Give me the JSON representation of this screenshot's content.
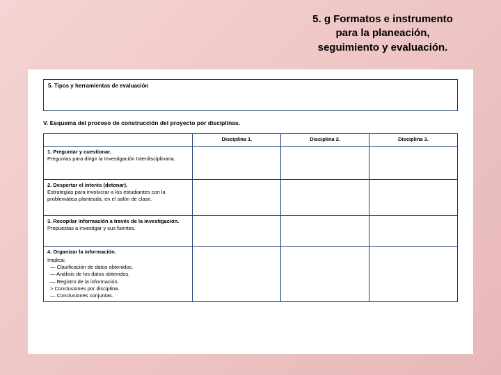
{
  "title": {
    "line1": "5. g Formatos e instrumento",
    "line2": "para la planeación,",
    "line3": "seguimiento y evaluación."
  },
  "boxA": {
    "label": "5. Tipos y herramientas de evaluación"
  },
  "sectionV": "V. Esquema del proceso de construcción del proyecto por disciplinas.",
  "headers": {
    "d1": "Disciplina 1.",
    "d2": "Disciplina 2.",
    "d3": "Disciplina 3."
  },
  "rows": {
    "r1": {
      "label": "1. Preguntar y cuestionar.",
      "sub": "Preguntas para dirigir la Investigación Interdisciplinaria."
    },
    "r2": {
      "label": "2. Despertar el interés (detonar).",
      "sub": "Estrategias para involucrar a los estudiantes con la problemática planteada, en el salón de clase."
    },
    "r3": {
      "label": "3. Recopilar información a través de la investigación.",
      "sub": "Propuestas a investigar y sus fuentes."
    },
    "r4": {
      "label": "4. Organizar la información.",
      "implies": "Implica:",
      "b1": "— Clasificación de datos obtenidos.",
      "b2": "— Análisis de los datos obtenidos.",
      "b3": "— Registro de la información.",
      "b4": "> Conclusiones por disciplina.",
      "b5": "— Conclusiones conjuntas."
    }
  }
}
